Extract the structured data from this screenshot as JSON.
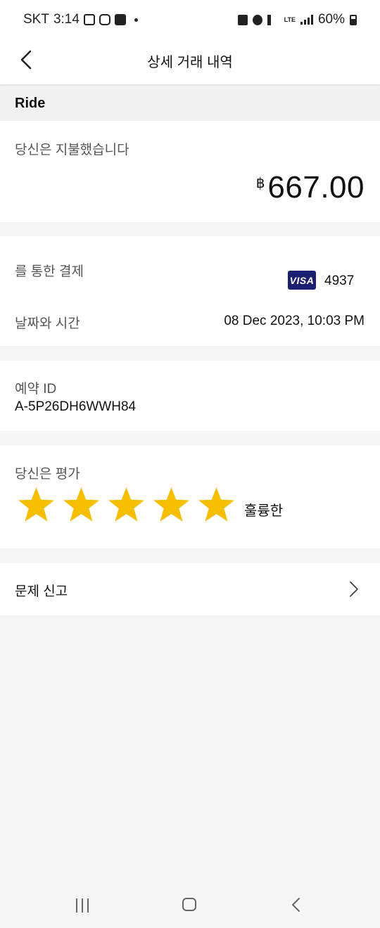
{
  "status_bar": {
    "carrier": "SKT",
    "time": "3:14",
    "lte": "LTE",
    "battery": "60%"
  },
  "header": {
    "title": "상세 거래 내역"
  },
  "section": {
    "title": "Ride"
  },
  "payment": {
    "label": "당신은 지불했습니다",
    "currency_symbol": "฿",
    "amount": "667.00"
  },
  "details": {
    "paid_via_label": "를 통한 결제",
    "card_brand": "VISA",
    "card_last4": "4937",
    "datetime_label": "날짜와 시간",
    "datetime_value": "08 Dec 2023, 10:03 PM"
  },
  "booking": {
    "label": "예약 ID",
    "id": "A-5P26DH6WWH84"
  },
  "rating": {
    "label": "당신은 평가",
    "stars": 5,
    "max_stars": 5,
    "text": "훌륭한"
  },
  "report": {
    "label": "문제 신고"
  },
  "colors": {
    "star": "#F5BE00",
    "visa_bg": "#1A1F71",
    "page_bg": "#F5F5F5"
  },
  "icons": {
    "back": "chevron-left-icon",
    "chevron": "chevron-right-icon",
    "star": "star-icon"
  }
}
